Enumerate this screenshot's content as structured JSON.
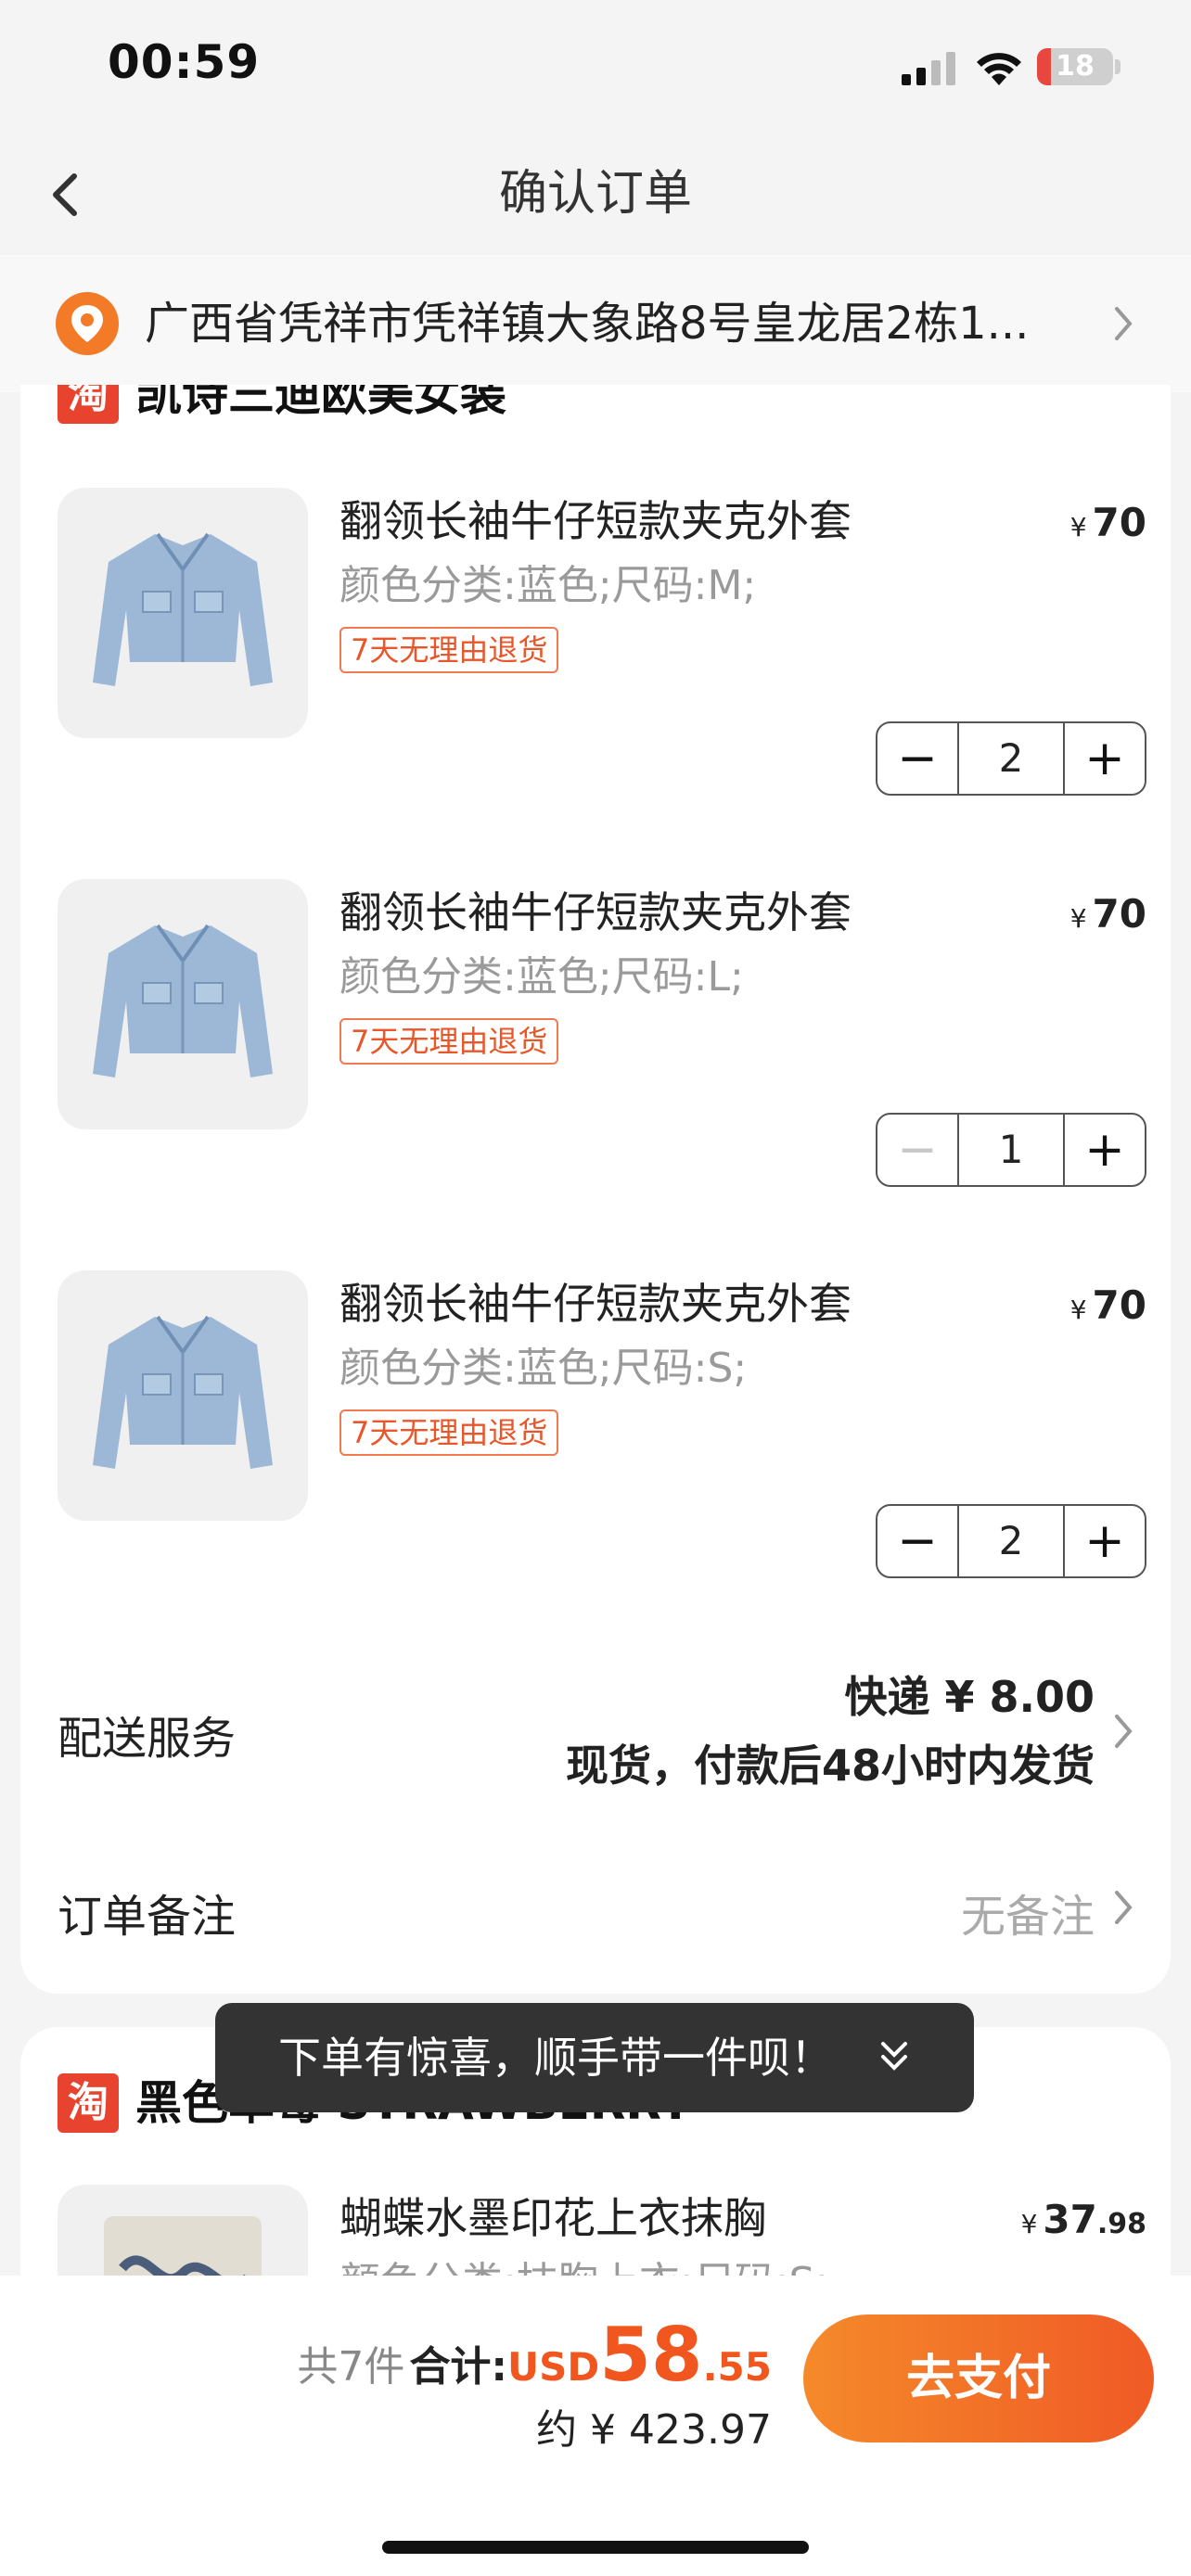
{
  "status_bar": {
    "time": "00:59",
    "battery": "18",
    "battery_level": 0.18
  },
  "nav": {
    "title": "确认订单"
  },
  "address": {
    "text": "广西省凭祥市凭祥镇大象路8号皇龙居2栋1..."
  },
  "shop1": {
    "badge": "淘",
    "name": "凯诗三迪欧美女装",
    "items": [
      {
        "title": "翻领长袖牛仔短款夹克外套",
        "spec": "颜色分类:蓝色;尺码:M;",
        "tag": "7天无理由退货",
        "currency": "¥",
        "price": "70",
        "qty": "2"
      },
      {
        "title": "翻领长袖牛仔短款夹克外套",
        "spec": "颜色分类:蓝色;尺码:L;",
        "tag": "7天无理由退货",
        "currency": "¥",
        "price": "70",
        "qty": "1"
      },
      {
        "title": "翻领长袖牛仔短款夹克外套",
        "spec": "颜色分类:蓝色;尺码:S;",
        "tag": "7天无理由退货",
        "currency": "¥",
        "price": "70",
        "qty": "2"
      }
    ],
    "shipping_label": "配送服务",
    "shipping_line1": "快递 ¥ 8.00",
    "shipping_line2": "现货，付款后48小时内发货",
    "note_label": "订单备注",
    "note_value": "无备注"
  },
  "shop2": {
    "badge": "淘",
    "name": "黑色草莓 STRAWBERRY",
    "item": {
      "title": "蝴蝶水墨印花上衣抹胸",
      "spec": "颜色分类:抹胸上衣;尺码:S;",
      "currency": "¥",
      "price_int": "37",
      "price_dec": ".98"
    }
  },
  "toast": {
    "text": "下单有惊喜，顺手带一件呗！"
  },
  "bottom_bar": {
    "count": "共7件",
    "total_label": "合计:",
    "currency": "USD",
    "total_int": "58",
    "total_dec": ".55",
    "approx": "约 ¥ 423.97",
    "pay_label": "去支付"
  },
  "colors": {
    "accent": "#f0561e",
    "tag": "#e8562a",
    "badge": "#e8432e"
  },
  "icons": [
    "back-chevron-icon",
    "location-pin-icon",
    "chevron-right-icon",
    "double-chevron-down-icon",
    "signal-icon",
    "wifi-icon",
    "battery-icon"
  ]
}
